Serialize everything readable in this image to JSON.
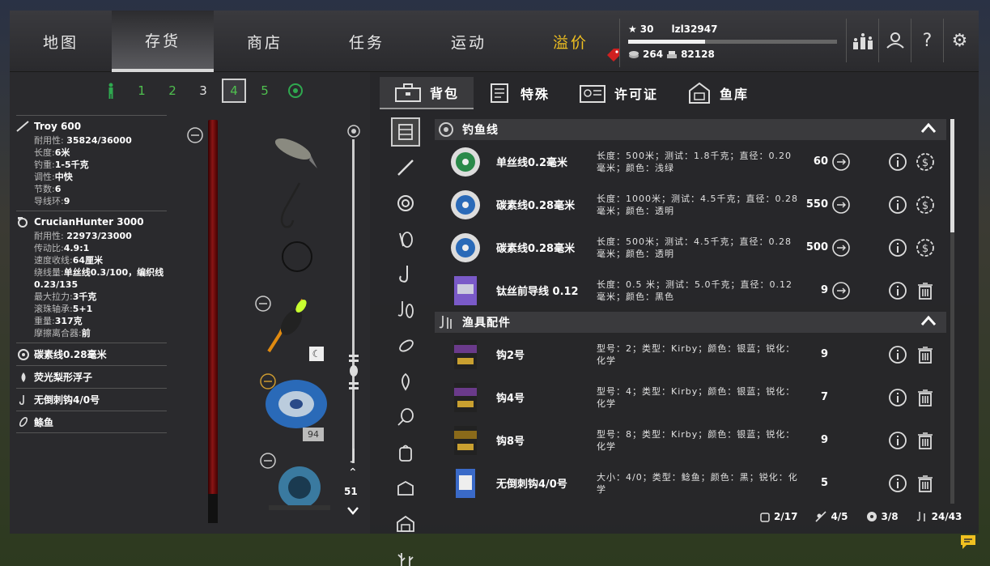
{
  "nav": {
    "tabs": [
      {
        "label": "地图"
      },
      {
        "label": "存货"
      },
      {
        "label": "商店"
      },
      {
        "label": "任务"
      },
      {
        "label": "运动"
      },
      {
        "label": "溢价"
      }
    ],
    "active_index": 1
  },
  "profile": {
    "level": "30",
    "username": "lzl32947",
    "xp_fraction": 0.37,
    "silver": "264",
    "gold": "82128"
  },
  "slots": {
    "items": [
      "1",
      "2",
      "3",
      "4",
      "5"
    ],
    "active": "4"
  },
  "rod": {
    "name": "Troy 600",
    "lines": [
      {
        "k": "耐用性: ",
        "v": "35824/36000"
      },
      {
        "k": "长度:",
        "v": "6米"
      },
      {
        "k": "钓重:",
        "v": "1-5千克"
      },
      {
        "k": "调性:",
        "v": "中快"
      },
      {
        "k": "节数:",
        "v": "6"
      },
      {
        "k": "导线环:",
        "v": "9"
      }
    ]
  },
  "reel": {
    "name": "CrucianHunter 3000",
    "lines": [
      {
        "k": "耐用性: ",
        "v": "22973/23000"
      },
      {
        "k": "传动比:",
        "v": "4.9:1"
      },
      {
        "k": "速度收线:",
        "v": "64厘米"
      },
      {
        "k": "绕线量:",
        "v": "单丝线0.3/100，编织线0.23/135"
      },
      {
        "k": "最大拉力:",
        "v": "3千克"
      },
      {
        "k": "滚珠轴承:",
        "v": "5+1"
      },
      {
        "k": "重量:",
        "v": "317克"
      },
      {
        "k": "摩擦离合器:",
        "v": "前"
      }
    ]
  },
  "parts": [
    {
      "label": "碳素线0.28毫米"
    },
    {
      "label": "荧光梨形浮子"
    },
    {
      "label": "无倒刺钩4/0号"
    },
    {
      "label": "鲦鱼"
    }
  ],
  "rig": {
    "line_badge": "94",
    "scroll_count": "51"
  },
  "inv_tabs": [
    {
      "label": "背包"
    },
    {
      "label": "特殊"
    },
    {
      "label": "许可证"
    },
    {
      "label": "鱼库"
    }
  ],
  "sections": [
    {
      "title": "钓鱼线",
      "items": [
        {
          "name": "单丝线0.2毫米",
          "desc": "长度：500米；测试：1.8千克；直径：0.20毫米；颜色：浅绿",
          "qty": "60",
          "thumb_color": "#2a8a4a"
        },
        {
          "name": "碳素线0.28毫米",
          "desc": "长度：1000米；测试：4.5千克；直径：0.28毫米；颜色：透明",
          "qty": "550",
          "thumb_color": "#2a6ab8"
        },
        {
          "name": "碳素线0.28毫米",
          "desc": "长度：500米；测试：4.5千克；直径：0.28毫米；颜色：透明",
          "qty": "500",
          "thumb_color": "#2a6ab8"
        },
        {
          "name": "钛丝前导线 0.12",
          "desc": "长度：0.5 米；测试：5.0千克；直径：0.12 毫米；颜色：黑色",
          "qty": "9",
          "thumb_color": "#7a5ac8"
        }
      ]
    },
    {
      "title": "渔具配件",
      "items": [
        {
          "name": "钩2号",
          "desc": "型号：2；类型：Kirby；颜色：银蓝；锐化：化学",
          "qty": "9",
          "thumb_color": "#6a3a8a"
        },
        {
          "name": "钩4号",
          "desc": "型号：4；类型：Kirby；颜色：银蓝；锐化：化学",
          "qty": "7",
          "thumb_color": "#6a3a8a"
        },
        {
          "name": "钩8号",
          "desc": "型号：8；类型：Kirby；颜色：银蓝；锐化：化学",
          "qty": "9",
          "thumb_color": "#8a6a1a"
        },
        {
          "name": "无倒刺钩4/0号",
          "desc": "大小：4/0；类型：鲶鱼；颜色：黑；锐化：化学",
          "qty": "5",
          "thumb_color": "#3a6ac8"
        }
      ]
    }
  ],
  "footer": {
    "bag": "2/17",
    "rods": "4/5",
    "reels": "3/8",
    "tackle": "24/43"
  }
}
